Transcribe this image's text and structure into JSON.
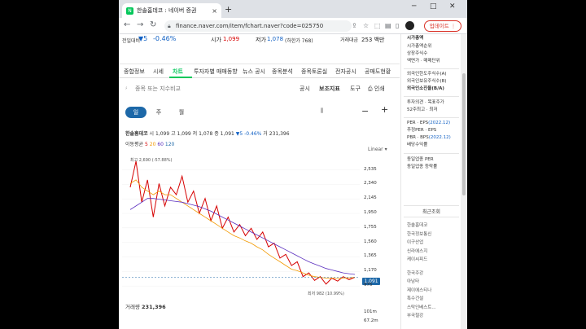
{
  "browser": {
    "tab_title": "한솔홈데코 : 네이버 증권",
    "tab_close": "×",
    "new_tab": "+",
    "url": "finance.naver.com/item/fchart.naver?code=025750",
    "update_label": "업데이트",
    "minimize": "─",
    "maximize": "□",
    "close": "✕"
  },
  "quote": {
    "prev_label": "전일대비",
    "change": "▼5",
    "change_pct": "-0.46%",
    "high_label": "시가",
    "high_value": "1,099",
    "low_label": "저가",
    "low_value": "1,078",
    "low_note": "(하한가 768)",
    "volume_label": "거래대금",
    "volume_value": "253 백만"
  },
  "nav": {
    "items": [
      "종합정보",
      "시세",
      "차트",
      "투자자별 매매동향",
      "뉴스 공시",
      "종목분석",
      "종목토론실",
      "전자공시",
      "공매도현황"
    ],
    "active": "차트"
  },
  "toolbar": {
    "search_placeholder": "종목 또는 지수비교",
    "disclosure": "공시",
    "indicator": "보조지표",
    "tools": "도구",
    "print": "인쇄"
  },
  "periods": [
    "일",
    "주",
    "월"
  ],
  "chart_header": {
    "name": "한솔홈데코",
    "open_label": "시",
    "open": "1,099",
    "high_label": "고",
    "high": "1,099",
    "low_label": "저",
    "low": "1,078",
    "close_label": "종",
    "close": "1,091",
    "change": "▼5",
    "change_pct": "-0.46%",
    "vol_label": "거",
    "vol": "231,396",
    "ma_label": "이동평균",
    "ma_values": [
      "5",
      "20",
      "60",
      "120"
    ],
    "scale": "Linear"
  },
  "chart_data": {
    "type": "line",
    "title": "",
    "xlabel": "",
    "ylabel": "",
    "yticks": [
      "2,535",
      "2,340",
      "2,145",
      "1,950",
      "1,755",
      "1,560",
      "1,365",
      "1,170",
      "975"
    ],
    "ylim": [
      900,
      2650
    ],
    "max_label": "최고 2,690 (-57.88%)",
    "min_label": "최저 982 (10.99%)",
    "current": "1,091",
    "series": [
      {
        "name": "",
        "color": "#d60000",
        "values": [
          2300,
          2650,
          2100,
          2400,
          1900,
          2350,
          2050,
          2300,
          2200,
          2450,
          2100,
          2250,
          1950,
          2150,
          1850,
          2050,
          1750,
          1900,
          1700,
          1800,
          1650,
          1750,
          1600,
          1700,
          1500,
          1550,
          1350,
          1400,
          1250,
          1300,
          1100,
          1150,
          1050,
          1100,
          1000,
          1080,
          1040,
          1100,
          1060,
          1091
        ]
      },
      {
        "name": "",
        "color": "#f29900",
        "values": [
          2350,
          2400,
          2300,
          2250,
          2200,
          2250,
          2200,
          2200,
          2150,
          2100,
          2050,
          2000,
          1950,
          1900,
          1850,
          1800,
          1750,
          1700,
          1650,
          1620,
          1580,
          1550,
          1500,
          1460,
          1400,
          1350,
          1300,
          1250,
          1200,
          1180,
          1150,
          1120,
          1100,
          1090,
          1080,
          1080,
          1075,
          1080,
          1085,
          1090
        ]
      },
      {
        "name": "",
        "color": "#5b2fbf",
        "values": [
          2000,
          2050,
          2100,
          2150,
          2150,
          2140,
          2130,
          2120,
          2110,
          2100,
          2080,
          2060,
          2040,
          2010,
          1980,
          1940,
          1900,
          1860,
          1820,
          1780,
          1740,
          1700,
          1660,
          1620,
          1580,
          1540,
          1500,
          1460,
          1420,
          1380,
          1340,
          1300,
          1270,
          1240,
          1210,
          1190,
          1170,
          1150,
          1140,
          1130
        ]
      }
    ],
    "volume_label": "거래량",
    "volume_value": "231,396",
    "volume_ticks": [
      "101m",
      "67.2m"
    ]
  },
  "right": {
    "market_cap": "시가총액",
    "market_cap_rank": "시가총액순위",
    "listed_shares": "상장주식수",
    "face_value": "액면가 · 매매단위",
    "foreign_limit": "외국인한도주식수(A)",
    "foreign_owned": "외국인보유주식수(B)",
    "foreign_ratio": "외국인소진율(B/A)",
    "opinion": "투자의견 · 목표주가",
    "week52": "52주최고 · 최저",
    "per_eps": "PER · EPS",
    "per_year": "(2022.12)",
    "est_per": "추정PER · EPS",
    "pbr_bps": "PBR · BPS",
    "pbr_year": "(2022.12)",
    "dividend": "배당수익률",
    "same_per": "동일업종 PER",
    "same_rate": "동일업종 등락률",
    "recent_title": "최근조회",
    "recent_items": [
      "한솔홈데코",
      "한국정보통신",
      "이구산업",
      "신라에스지",
      "케이씨피드",
      "한국주강",
      "아남타",
      "제이에스티나",
      "특수건설",
      "스탁인베스트...",
      "부국철강"
    ]
  },
  "colors": {
    "accent": "#03c75a",
    "down": "#1261c4",
    "up": "#d60000",
    "ma5": "#d60000",
    "ma20": "#f29900",
    "ma60": "#5b2fbf",
    "ma120": "#1d68a8"
  }
}
